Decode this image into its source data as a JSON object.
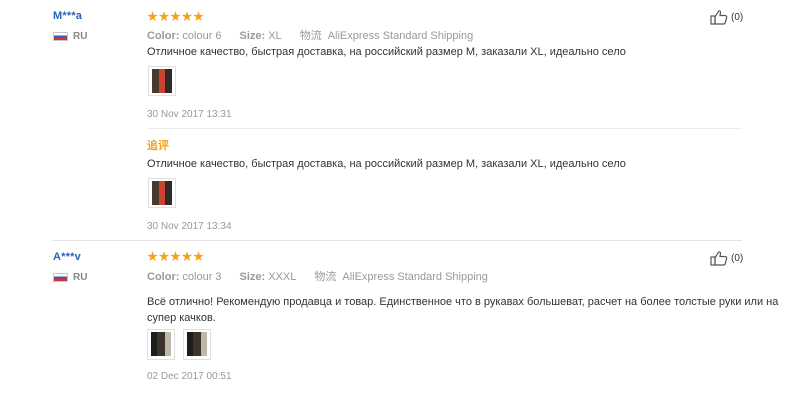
{
  "reviews": [
    {
      "user": "M***a",
      "country": "RU",
      "stars": 5,
      "color_label": "Color:",
      "color_value": "colour 6",
      "size_label": "Size:",
      "size_value": "XL",
      "shipping_label": "物流",
      "shipping_value": "AliExpress Standard Shipping",
      "text": "Отличное качество, быстрая доставка, на российский размер М, заказали XL, идеально село",
      "date": "30 Nov 2017 13:31",
      "likes": "(0)",
      "additional": {
        "label": "追评",
        "text": "Отличное качество, быстрая доставка, на российский размер М, заказали XL, идеально село",
        "date": "30 Nov 2017 13:34"
      }
    },
    {
      "user": "A***v",
      "country": "RU",
      "stars": 5,
      "color_label": "Color:",
      "color_value": "colour 3",
      "size_label": "Size:",
      "size_value": "XXXL",
      "shipping_label": "物流",
      "shipping_value": "AliExpress Standard Shipping",
      "text_line1": "Всё отлично! Рекомендую продавца и товар. Единственное что в рукавах большеват, расчет на более толстые руки или на",
      "text_line2": "супер качков.",
      "date": "02 Dec 2017 00:51",
      "likes": "(0)"
    }
  ],
  "icons": {
    "star": "star-icon",
    "like": "thumbs-up-icon",
    "flag": "russia-flag-icon"
  },
  "colors": {
    "star": "#f4a21c",
    "username": "#2a62b5",
    "muted": "#999999"
  }
}
